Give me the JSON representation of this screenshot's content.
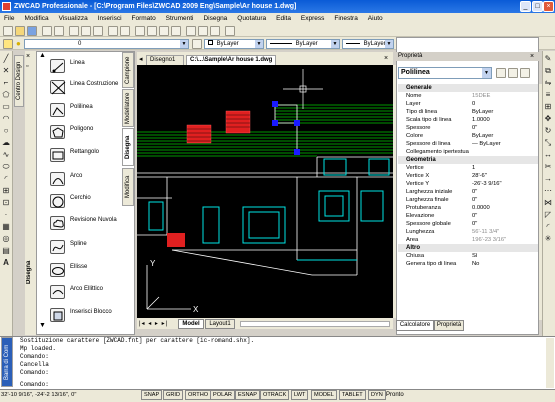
{
  "window": {
    "title": "ZWCAD Professionale - [C:\\Program Files\\ZWCAD 2009 Eng\\Sample\\Ar house 1.dwg]"
  },
  "menu": [
    "File",
    "Modifica",
    "Visualizza",
    "Inserisci",
    "Formato",
    "Strumenti",
    "Disegna",
    "Quotatura",
    "Edita",
    "Express",
    "Finestra",
    "Aiuto"
  ],
  "layer_toolbar": {
    "layer_value": "0",
    "color_value": "ByLayer",
    "linetype_value": "ByLayer",
    "lineweight_value": "ByLayer"
  },
  "left_dock_tab": "Centro Design",
  "palette": {
    "title": "Disegna",
    "side_tabs": [
      "Campione",
      "Modellatore",
      "Disegna",
      "Modifica"
    ],
    "items": [
      {
        "icon": "line-icon",
        "label": "Linea"
      },
      {
        "icon": "construction-line-icon",
        "label": "Linea Costruzione"
      },
      {
        "icon": "polyline-icon",
        "label": "Polilinea"
      },
      {
        "icon": "polygon-icon",
        "label": "Poligono"
      },
      {
        "icon": "rectangle-icon",
        "label": "Rettangolo"
      },
      {
        "icon": "arc-icon",
        "label": "Arco"
      },
      {
        "icon": "circle-icon",
        "label": "Cerchio"
      },
      {
        "icon": "revision-cloud-icon",
        "label": "Revisione Nuvola"
      },
      {
        "icon": "spline-icon",
        "label": "Spline"
      },
      {
        "icon": "ellipse-icon",
        "label": "Ellisse"
      },
      {
        "icon": "elliptical-arc-icon",
        "label": "Arco Ellittico"
      },
      {
        "icon": "insert-block-icon",
        "label": "Inserisci Blocco"
      }
    ]
  },
  "documents": {
    "tabs": [
      "Disegno1",
      "C:\\...\\Sample\\Ar house 1.dwg"
    ],
    "layout_tabs": [
      "Model",
      "Layout1"
    ]
  },
  "properties": {
    "title": "Proprietà",
    "selection": "Polilinea",
    "sections": [
      {
        "name": "Generale",
        "rows": [
          {
            "k": "Nome",
            "v": "15DEE",
            "dim": true
          },
          {
            "k": "Layer",
            "v": "0"
          },
          {
            "k": "Tipo di linea",
            "v": "ByLayer"
          },
          {
            "k": "Scala tipo di linea",
            "v": "1.0000"
          },
          {
            "k": "Spessore",
            "v": "0\""
          },
          {
            "k": "Colore",
            "v": "ByLayer"
          },
          {
            "k": "Spessore di linea",
            "v": "— ByLayer"
          },
          {
            "k": "Collegamento ipertestua",
            "v": ""
          }
        ]
      },
      {
        "name": "Geometria",
        "rows": [
          {
            "k": "Vertice",
            "v": "1"
          },
          {
            "k": "Vertice X",
            "v": "28'-6\""
          },
          {
            "k": "Vertice Y",
            "v": "-26'-3 9/16\""
          },
          {
            "k": "Larghezza iniziale",
            "v": "0\""
          },
          {
            "k": "Larghezza finale",
            "v": "0\""
          },
          {
            "k": "Protuberanza",
            "v": "0.0000"
          },
          {
            "k": "Elevazione",
            "v": "0\""
          },
          {
            "k": "Spessore globale",
            "v": "0\""
          },
          {
            "k": "Lunghezza",
            "v": "56'-11 3/4\"",
            "dim": true
          },
          {
            "k": "Area",
            "v": "196'-23 3/16\"",
            "dim": true
          }
        ]
      },
      {
        "name": "Altro",
        "rows": [
          {
            "k": "Chiusa",
            "v": "Sì"
          },
          {
            "k": "Genera tipo di linea",
            "v": "No"
          }
        ]
      }
    ],
    "bottom_tabs": [
      "Calcolatore",
      "Proprietà"
    ]
  },
  "command": {
    "dock_label": "Barra di Com",
    "lines": [
      "Sostituzione carattere [ZWCAD.fnt] per carattere [ic-romand.shx].",
      "Mp loaded.",
      "Comando:",
      "Cancella",
      "Comando:",
      "",
      "Comando:"
    ]
  },
  "status": {
    "coords": "32'-10 9/16\",  -24'-2 13/16\",  0\"",
    "buttons": [
      "SNAP",
      "GRID",
      "ORTHO",
      "POLAR",
      "ESNAP",
      "OTRACK",
      "LWT",
      "MODEL",
      "TABLET",
      "DYN"
    ],
    "state": "Pronto"
  },
  "colors": {
    "canvas": "#000000",
    "green": "#00c800",
    "cyan": "#00e5e5",
    "red": "#e02020",
    "white": "#ffffff",
    "grip": "#1a1aff",
    "titlebar": "#0a5bd6"
  }
}
